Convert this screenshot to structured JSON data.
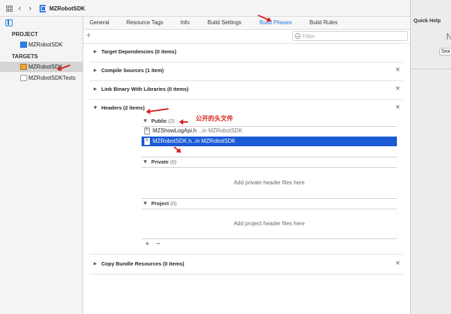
{
  "jumpbar": {
    "title": "MZRobotSDK"
  },
  "sidebar": {
    "project_header": "PROJECT",
    "targets_header": "TARGETS",
    "project_item": "MZRobotSDK",
    "target_items": [
      "MZRobotSDK",
      "MZRobotSDKTests"
    ]
  },
  "tabs": [
    "General",
    "Resource Tags",
    "Info",
    "Build Settings",
    "Build Phases",
    "Build Rules"
  ],
  "active_tab": "Build Phases",
  "toolbar": {
    "add": "+",
    "filter_placeholder": "Filter"
  },
  "phases": {
    "target_dependencies": "Target Dependencies (0 items)",
    "compile_sources": "Compile Sources (1 item)",
    "link_binary": "Link Binary With Libraries (0 items)",
    "headers": "Headers (2 items)",
    "copy_bundle": "Copy Bundle Resources (0 items)"
  },
  "headers": {
    "public": {
      "title": "Public",
      "count": "(2)"
    },
    "private": {
      "title": "Private",
      "count": "(0)",
      "placeholder": "Add private header files here"
    },
    "project": {
      "title": "Project",
      "count": "(0)",
      "placeholder": "Add project header files here"
    },
    "files": [
      {
        "name": "MZShowLogApi.h",
        "location": "...in MZRobotSDK"
      },
      {
        "name": "MZRobotSDK.h",
        "location": "...in MZRobotSDK"
      }
    ],
    "add": "+",
    "remove": "−"
  },
  "annotation": {
    "public_headers": "公开的头文件"
  },
  "quick_help": {
    "title": "Quick Help",
    "no_selection": "N",
    "search_button": "Sea"
  },
  "colors": {
    "accent": "#1f76e8",
    "selection": "#1b5bd6",
    "annotation": "#d8231d"
  }
}
